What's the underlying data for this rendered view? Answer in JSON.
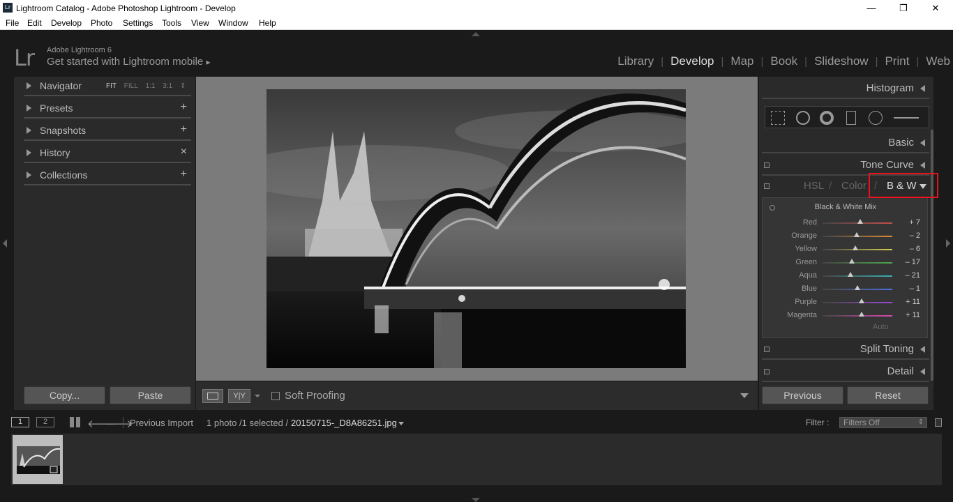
{
  "window": {
    "title": "Lightroom Catalog - Adobe Photoshop Lightroom - Develop",
    "icon_text": "Lr",
    "minimize": "—",
    "maximize": "❐",
    "close": "✕"
  },
  "menu": [
    "File",
    "Edit",
    "Develop",
    "Photo",
    "Settings",
    "Tools",
    "View",
    "Window",
    "Help"
  ],
  "identity": {
    "logo": "Lr",
    "version": "Adobe Lightroom 6",
    "mobile": "Get started with Lightroom mobile",
    "mobile_arrow": "▸"
  },
  "modules": [
    "Library",
    "Develop",
    "Map",
    "Book",
    "Slideshow",
    "Print",
    "Web"
  ],
  "active_module": "Develop",
  "left_panel": {
    "navigator": {
      "label": "Navigator",
      "zoom": [
        "FIT",
        "FILL",
        "1:1",
        "3:1"
      ],
      "zoom_active": "FIT",
      "zoom_arrows": "⇕"
    },
    "presets": {
      "label": "Presets",
      "action": "+"
    },
    "snapshots": {
      "label": "Snapshots",
      "action": "+"
    },
    "history": {
      "label": "History",
      "action": "×"
    },
    "collections": {
      "label": "Collections",
      "action": "+"
    },
    "copy_button": "Copy...",
    "paste_button": "Paste"
  },
  "toolbar": {
    "soft_proofing": "Soft Proofing",
    "compare_label": "Y|Y"
  },
  "right_panel": {
    "histogram": "Histogram",
    "basic": "Basic",
    "tone_curve": "Tone Curve",
    "hsl_tabs": [
      "HSL",
      "Color",
      "B & W"
    ],
    "hsl_sep": "/",
    "active_tab": "B & W",
    "bw_title": "Black & White Mix",
    "mix": [
      {
        "label": "Red",
        "value": "+ 7",
        "num": 7,
        "color": "#c0504d"
      },
      {
        "label": "Orange",
        "value": "– 2",
        "num": -2,
        "color": "#d9883a"
      },
      {
        "label": "Yellow",
        "value": "– 6",
        "num": -6,
        "color": "#d8d24a"
      },
      {
        "label": "Green",
        "value": "– 17",
        "num": -17,
        "color": "#4aa84a"
      },
      {
        "label": "Aqua",
        "value": "– 21",
        "num": -21,
        "color": "#3ab0b0"
      },
      {
        "label": "Blue",
        "value": "– 1",
        "num": -1,
        "color": "#4a70d8"
      },
      {
        "label": "Purple",
        "value": "+ 11",
        "num": 11,
        "color": "#9a4ad8"
      },
      {
        "label": "Magenta",
        "value": "+ 11",
        "num": 11,
        "color": "#d84ab0"
      }
    ],
    "auto": "Auto",
    "split_toning": "Split Toning",
    "detail": "Detail",
    "previous_button": "Previous",
    "reset_button": "Reset"
  },
  "filmstrip": {
    "view1": "1",
    "view2": "2",
    "source": "Previous Import",
    "count": "1 photo /1 selected /",
    "filename": "20150715-_D8A86251.jpg",
    "filter_label": "Filter :",
    "filter_value": "Filters Off"
  }
}
